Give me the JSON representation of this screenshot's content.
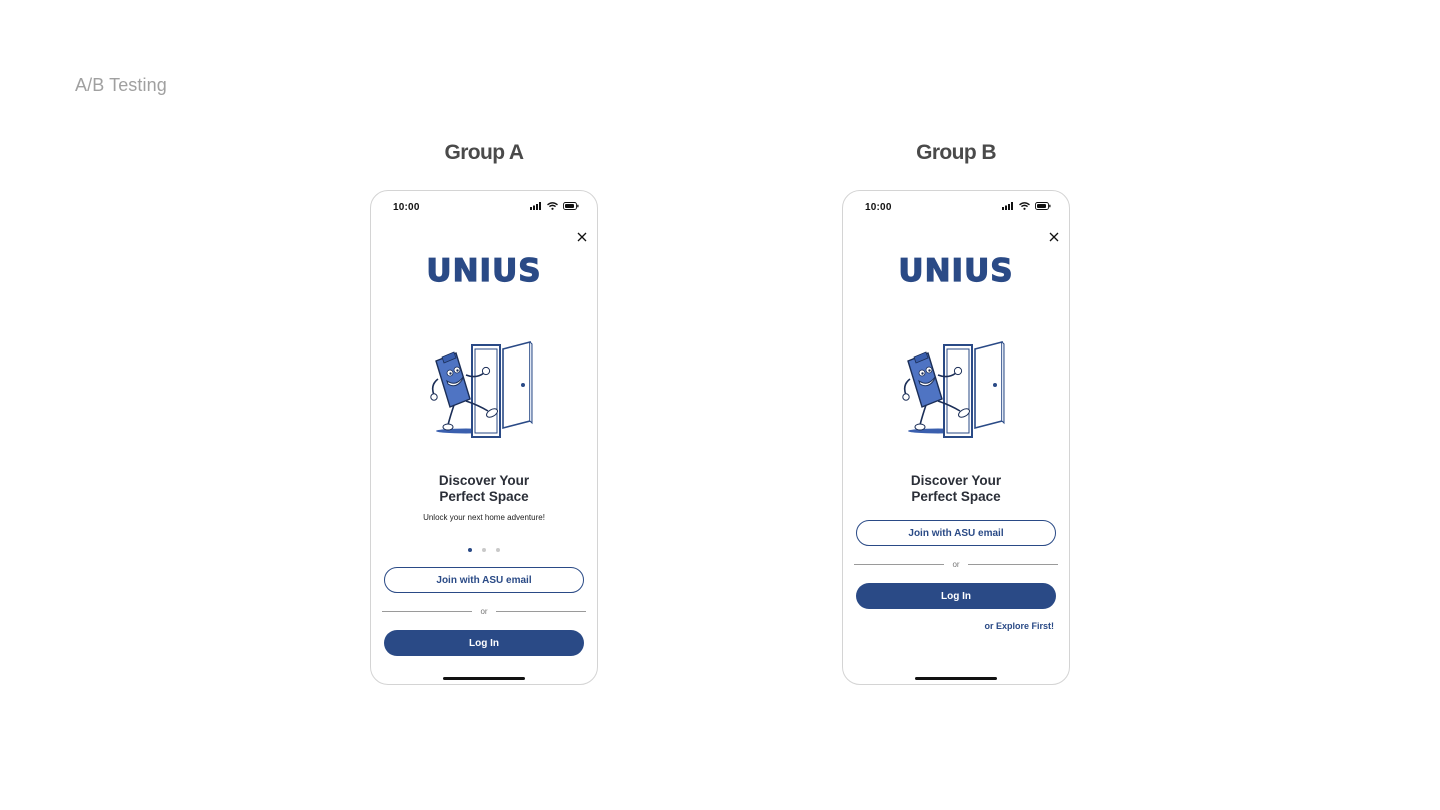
{
  "page": {
    "title": "A/B Testing"
  },
  "colors": {
    "brand": "#2a4a86",
    "heading": "#2b2f38",
    "muted": "#a0a0a0"
  },
  "groups": [
    {
      "label": "Group A",
      "status_time": "10:00",
      "logo": "UNIUS",
      "headline_line1": "Discover Your",
      "headline_line2": "Perfect Space",
      "subheadline": "Unlock your next home adventure!",
      "pager": {
        "count": 3,
        "active": 1
      },
      "join_label": "Join with ASU email",
      "divider_label": "or",
      "login_label": "Log In"
    },
    {
      "label": "Group B",
      "status_time": "10:00",
      "logo": "UNIUS",
      "headline_line1": "Discover Your",
      "headline_line2": "Perfect Space",
      "join_label": "Join with ASU email",
      "divider_label": "or",
      "login_label": "Log In",
      "explore_label": "or Explore First!"
    }
  ],
  "icons": {
    "close": "close-icon",
    "signal": "cellular-signal-icon",
    "wifi": "wifi-icon",
    "battery": "battery-icon",
    "mascot": "mascot-door-illustration"
  }
}
